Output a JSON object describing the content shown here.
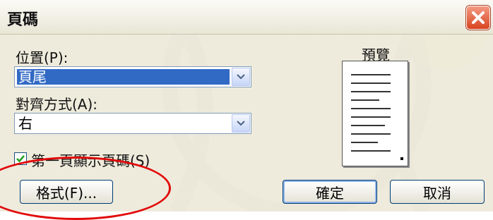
{
  "dialog": {
    "title": "頁碼",
    "position_label": "位置(P):",
    "position_value": "頁尾",
    "alignment_label": "對齊方式(A):",
    "alignment_value": "右",
    "checkbox_label": "第一頁顯示頁碼(S)",
    "checkbox_checked": true,
    "preview_label": "預覽",
    "format_button": "格式(F)...",
    "ok_button": "確定",
    "cancel_button": "取消"
  },
  "icons": [
    "close-icon",
    "dropdown-arrow-icon",
    "checkmark-icon"
  ],
  "colors": {
    "selection": "#316ac5",
    "close_button": "#d8431e",
    "highlight_ellipse": "#e20a0a"
  }
}
